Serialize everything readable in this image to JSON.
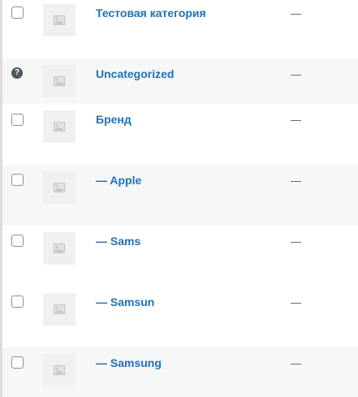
{
  "rows": [
    {
      "name": "Тестовая категория",
      "description": "—",
      "control": "checkbox"
    },
    {
      "name": "Uncategorized",
      "description": "—",
      "control": "help"
    },
    {
      "name": "Бренд",
      "description": "—",
      "control": "checkbox"
    },
    {
      "name": "— Apple",
      "description": "—",
      "control": "checkbox"
    },
    {
      "name": "— Sams",
      "description": "—",
      "control": "checkbox"
    },
    {
      "name": "— Samsun",
      "description": "—",
      "control": "checkbox"
    },
    {
      "name": "— Samsung",
      "description": "—",
      "control": "checkbox"
    }
  ],
  "help_symbol": "?",
  "icons": {
    "thumbnail": "image-placeholder-icon",
    "help": "help-icon"
  },
  "colors": {
    "link": "#2271b1",
    "row_alt": "#f6f7f7",
    "row": "#ffffff"
  }
}
